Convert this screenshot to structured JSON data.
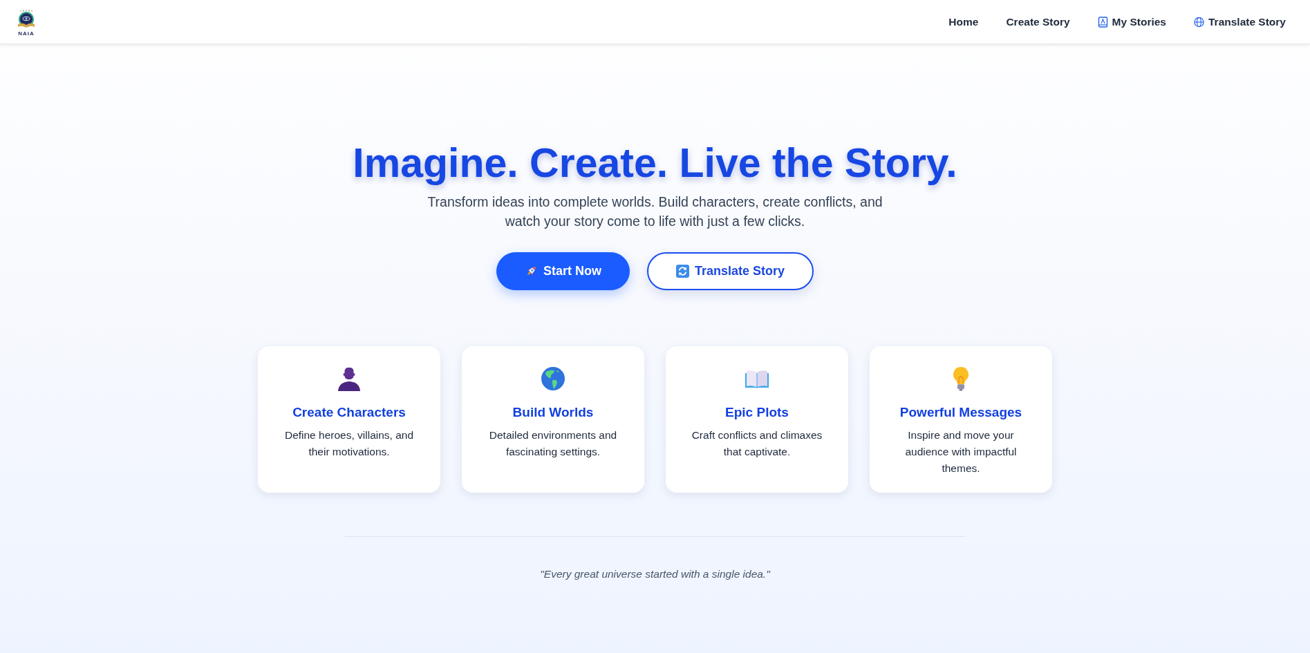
{
  "header": {
    "logo": {
      "text": "NAIA"
    },
    "nav": [
      {
        "label": "Home"
      },
      {
        "label": "Create Story"
      },
      {
        "label": "My Stories"
      },
      {
        "label": "Translate Story"
      }
    ]
  },
  "hero": {
    "title": "Imagine. Create. Live the Story.",
    "subtitle": "Transform ideas into complete worlds. Build characters, create conflicts, and watch your story come to life with just a few clicks.",
    "buttons": [
      {
        "label": "Start Now",
        "kind": "primary"
      },
      {
        "label": "Translate Story",
        "kind": "outline"
      }
    ]
  },
  "features": [
    {
      "title": "Create Characters",
      "description": "Define heroes, villains, and their motivations."
    },
    {
      "title": "Build Worlds",
      "description": "Detailed environments and fascinating settings."
    },
    {
      "title": "Epic Plots",
      "description": "Craft conflicts and climaxes that captivate."
    },
    {
      "title": "Powerful Messages",
      "description": "Inspire and move your audience with impactful themes."
    }
  ],
  "quote": "\"Every great universe started with a single idea.\""
}
